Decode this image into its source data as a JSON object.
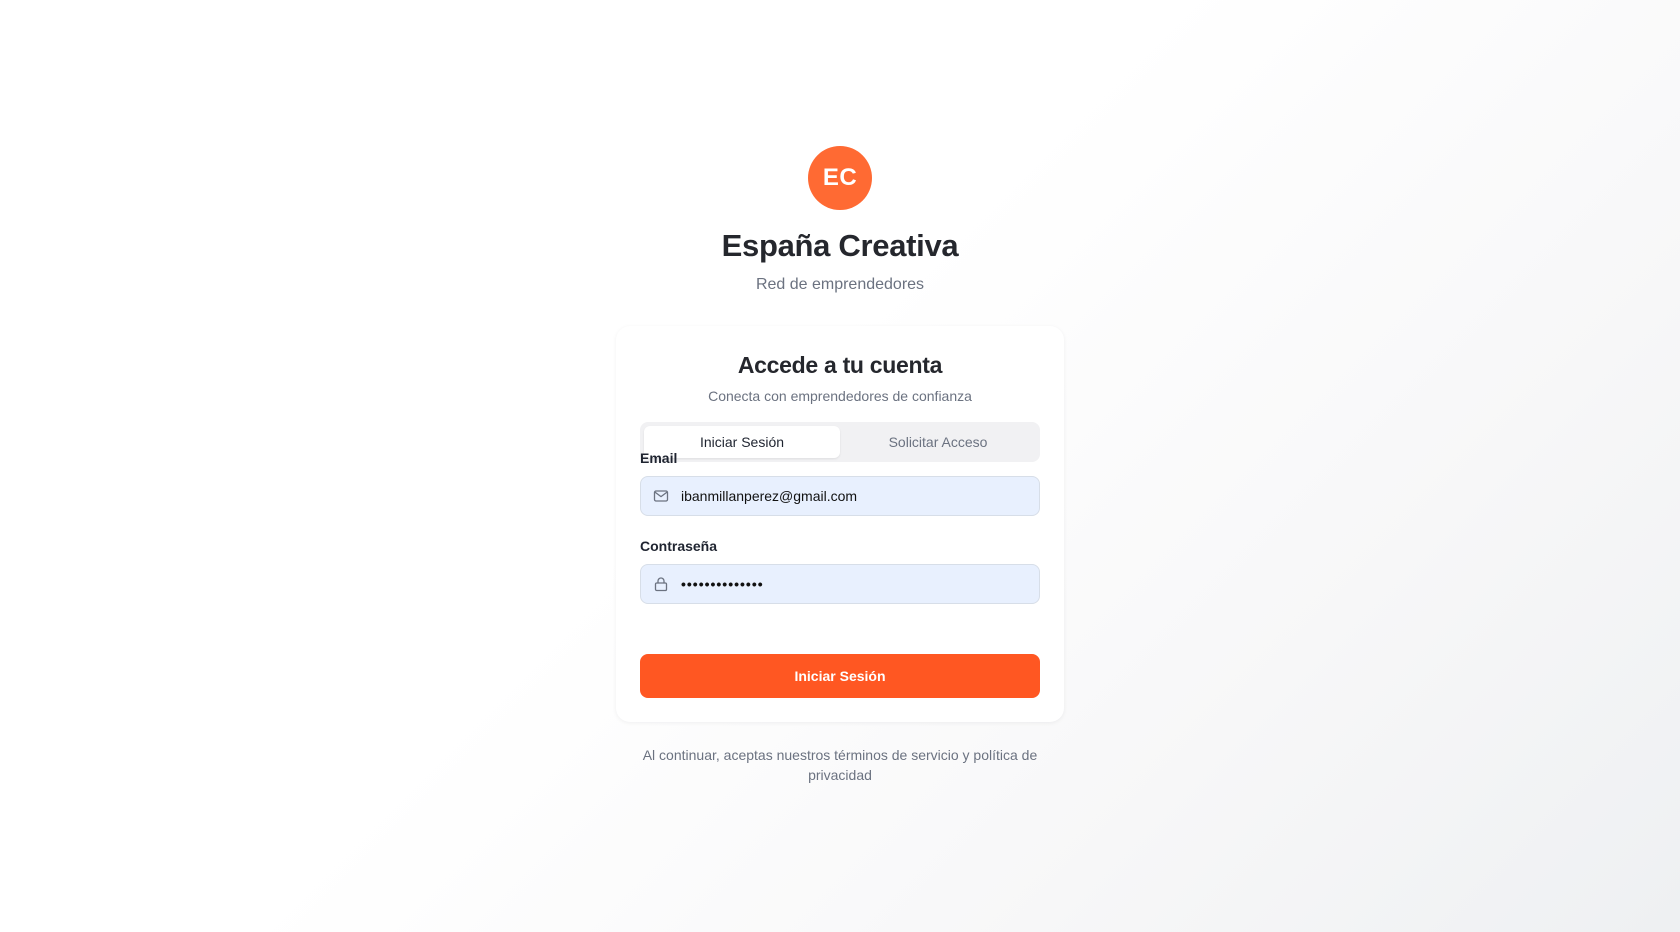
{
  "brand": {
    "logo_initials": "EC",
    "logo_color": "#ff6a33",
    "title": "España Creativa",
    "subtitle": "Red de emprendedores"
  },
  "card": {
    "title": "Accede a tu cuenta",
    "subtitle": "Conecta con emprendedores de confianza",
    "tabs": [
      {
        "label": "Iniciar Sesión",
        "active": true
      },
      {
        "label": "Solicitar Acceso",
        "active": false
      }
    ],
    "email": {
      "label": "Email",
      "icon": "mail-icon",
      "value": "ibanmillanperez@gmail.com"
    },
    "password": {
      "label": "Contraseña",
      "icon": "lock-icon",
      "value": "••••••••••••••"
    },
    "submit_label": "Iniciar Sesión",
    "accent_color": "#ff5722"
  },
  "footer": {
    "terms_text": "Al continuar, aceptas nuestros términos de servicio y política de privacidad"
  }
}
